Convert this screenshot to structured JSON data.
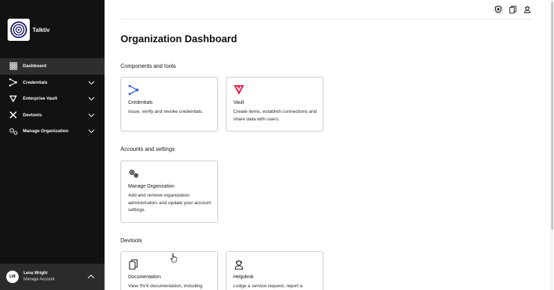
{
  "brand": {
    "name": "Talktiv"
  },
  "sidebar": {
    "items": [
      {
        "label": "Dashboard",
        "icon": "grid-icon",
        "active": true
      },
      {
        "label": "Credentials",
        "icon": "credentials-icon"
      },
      {
        "label": "Enterprise Vault",
        "icon": "vault-icon"
      },
      {
        "label": "Devtools",
        "icon": "tools-icon"
      },
      {
        "label": "Manage Organization",
        "icon": "organization-icon"
      }
    ]
  },
  "user": {
    "initials": "LW",
    "name": "Lena Wright",
    "sub": "Manage Account"
  },
  "header": {
    "icons": [
      "shield-icon",
      "docs-icon",
      "support-icon"
    ]
  },
  "main": {
    "title": "Organization Dashboard",
    "sections": {
      "components": "Components and tools",
      "accounts": "Accounts and settings",
      "devtools": "Devtools"
    },
    "cards": {
      "credentials": {
        "title": "Credentials",
        "desc": "Issue, verify and revoke credentials."
      },
      "vault": {
        "title": "Vault",
        "desc": "Create items, establish connections and share data with users."
      },
      "manage": {
        "title": "Manage Organization",
        "desc": "Add and remove organization administrators and update your account settings."
      },
      "documentation": {
        "title": "Documentation",
        "desc": "View SVX documentation, including"
      },
      "helpdesk": {
        "title": "Helpdesk",
        "desc": "Lodge a service request, report a"
      }
    }
  },
  "colors": {
    "sidebar_bg": "#121212",
    "active_item": "#2e2e2e",
    "credentials_accent": "#2f5fe0",
    "vault_accent": "#e0244f"
  }
}
